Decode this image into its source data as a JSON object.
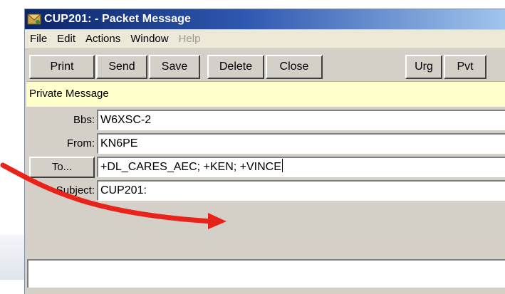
{
  "window": {
    "title": "CUP201: - Packet Message",
    "icon": "packet-app-icon"
  },
  "menubar": {
    "items": [
      {
        "label": "File",
        "enabled": true
      },
      {
        "label": "Edit",
        "enabled": true
      },
      {
        "label": "Actions",
        "enabled": true
      },
      {
        "label": "Window",
        "enabled": true
      },
      {
        "label": "Help",
        "enabled": false
      }
    ]
  },
  "toolbar": {
    "print": "Print",
    "send": "Send",
    "save": "Save",
    "delete": "Delete",
    "close": "Close",
    "urg": "Urg",
    "pvt": "Pvt"
  },
  "banner": {
    "text": "Private Message",
    "color": "#ffffcc"
  },
  "form": {
    "bbs": {
      "label": "Bbs:",
      "value": "W6XSC-2"
    },
    "from": {
      "label": "From:",
      "value": "KN6PE"
    },
    "to": {
      "button_label": "To...",
      "value": "+DL_CARES_AEC; +KEN; +VINCE"
    },
    "subject": {
      "label": "Subject:",
      "value": "CUP201:"
    }
  },
  "annotation": {
    "arrow_color": "#e8231a",
    "points_to": "to-field"
  }
}
